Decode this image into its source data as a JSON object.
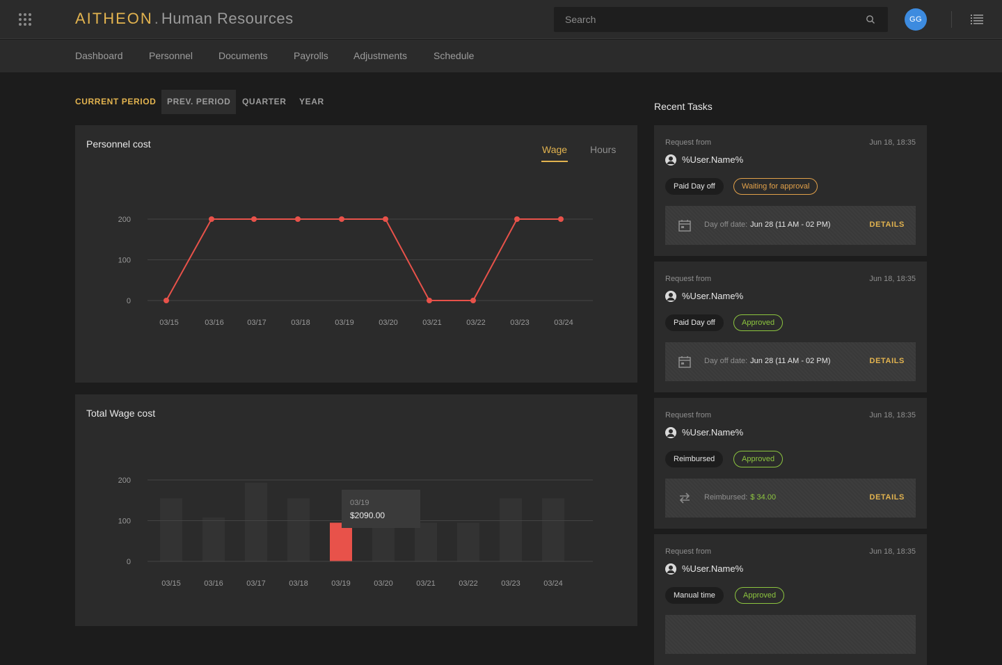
{
  "app": {
    "brand": "AITHEON",
    "separator": ".",
    "section": "Human Resources"
  },
  "search": {
    "placeholder": "Search"
  },
  "user": {
    "initials": "GG"
  },
  "nav": {
    "items": [
      "Dashboard",
      "Personnel",
      "Documents",
      "Payrolls",
      "Adjustments",
      "Schedule"
    ]
  },
  "periods": {
    "items": [
      "CURRENT PERIOD",
      "PREV. PERIOD",
      "QUARTER",
      "YEAR"
    ],
    "active": "CURRENT PERIOD",
    "hovered": "PREV. PERIOD"
  },
  "personnel_cost": {
    "title": "Personnel cost",
    "tabs": [
      "Wage",
      "Hours"
    ],
    "active_tab": "Wage"
  },
  "total_wage": {
    "title": "Total Wage cost",
    "tooltip": {
      "label": "03/19",
      "value": "$2090.00"
    }
  },
  "chart_data": [
    {
      "type": "line",
      "title": "Personnel cost",
      "categories": [
        "03/15",
        "03/16",
        "03/17",
        "03/18",
        "03/19",
        "03/20",
        "03/21",
        "03/22",
        "03/23",
        "03/24"
      ],
      "values": [
        0,
        200,
        200,
        200,
        200,
        200,
        0,
        0,
        200,
        200
      ],
      "yticks": [
        0,
        100,
        200
      ],
      "ylim": [
        0,
        200
      ],
      "grid": true,
      "color": "#e8524a"
    },
    {
      "type": "bar",
      "title": "Total Wage cost",
      "categories": [
        "03/15",
        "03/16",
        "03/17",
        "03/18",
        "03/19",
        "03/20",
        "03/21",
        "03/22",
        "03/23",
        "03/24"
      ],
      "values": [
        155,
        108,
        193,
        155,
        95,
        95,
        95,
        95,
        155,
        155
      ],
      "highlighted": "03/19",
      "yticks": [
        0,
        100,
        200
      ],
      "ylim": [
        0,
        200
      ],
      "grid": true,
      "color": "#333333",
      "highlight_color": "#e8524a"
    }
  ],
  "tasks": {
    "title": "Recent Tasks",
    "details_label": "DETAILS",
    "items": [
      {
        "request_label": "Request from",
        "time": "Jun 18, 18:35",
        "user": "%User.Name%",
        "type": "Paid Day off",
        "status": "Waiting for approval",
        "status_color": "#e2a14a",
        "icon": "calendar-icon",
        "detail_label": "Day off date:",
        "detail_value": "Jun 28 (11 AM - 02 PM)",
        "detail_color": "#e6e6e6"
      },
      {
        "request_label": "Request from",
        "time": "Jun 18, 18:35",
        "user": "%User.Name%",
        "type": "Paid Day off",
        "status": "Approved",
        "status_color": "#8dc63f",
        "icon": "calendar-icon",
        "detail_label": "Day off date:",
        "detail_value": "Jun 28 (11 AM - 02 PM)",
        "detail_color": "#e6e6e6"
      },
      {
        "request_label": "Request from",
        "time": "Jun 18, 18:35",
        "user": "%User.Name%",
        "type": "Reimbursed",
        "status": "Approved",
        "status_color": "#8dc63f",
        "icon": "swap-icon",
        "detail_label": "Reimbursed:",
        "detail_value": "$ 34.00",
        "detail_color": "#8dc63f"
      },
      {
        "request_label": "Request from",
        "time": "Jun 18, 18:35",
        "user": "%User.Name%",
        "type": "Manual time",
        "status": "Approved",
        "status_color": "#8dc63f",
        "icon": "",
        "detail_label": "",
        "detail_value": "",
        "detail_color": "#e6e6e6"
      }
    ]
  }
}
